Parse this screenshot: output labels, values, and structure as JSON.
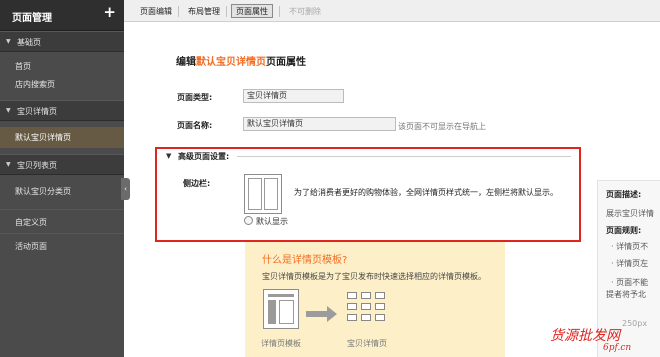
{
  "sidebar": {
    "title": "页面管理",
    "add_icon": "+",
    "sections": [
      {
        "label": "基础页",
        "items": [
          "首页",
          "店内搜索页"
        ]
      },
      {
        "label": "宝贝详情页",
        "items": [
          "默认宝贝详情页"
        ]
      },
      {
        "label": "宝贝列表页",
        "items": [
          "默认宝贝分类页"
        ]
      }
    ],
    "extra_items": [
      "自定义页",
      "活动页面"
    ],
    "collapse_icon": "‹"
  },
  "topbar": {
    "tabs": [
      "页面编辑",
      "布局管理",
      "页面属性",
      "不可删除"
    ]
  },
  "main": {
    "heading_prefix": "编辑",
    "heading_highlight": "默认宝贝详情页",
    "heading_suffix": "页面属性",
    "type_label": "页面类型:",
    "type_value": "宝贝详情页",
    "name_label": "页面名称:",
    "name_value": "默认宝贝详情页",
    "name_hint": "该页面不可显示在导航上",
    "advanced_title": "高级页面设置:",
    "sidebar_label": "侧边栏:",
    "layout_desc": "为了给消费者更好的购物体验，全网详情页样式统一，左侧栏将默认显示。",
    "radio_label": "默认显示"
  },
  "info": {
    "title": "什么是详情页模板?",
    "desc": "宝贝详情页模板是为了宝贝发布时快速选择相应的详情页模板。",
    "caption_left": "详情页模板",
    "caption_right": "宝贝详情页"
  },
  "right_panel": {
    "desc_title": "页面描述:",
    "desc_text": "展示宝贝详情",
    "rules_title": "页面规则:",
    "rules": [
      "· 详情页不",
      "· 详情页左",
      "· 页面不能",
      "提者将予北"
    ],
    "footer": "250px"
  },
  "watermark": {
    "text": "货源批发网",
    "site": "6pf.cn"
  },
  "colors": {
    "accent": "#f36c21",
    "highlight_border": "#e0251f",
    "sidebar_bg": "#4b4b4b",
    "sidebar_active": "#665a44",
    "info_bg": "#fdf0c9"
  },
  "icons": {
    "add": "plus-icon",
    "collapse": "chevron-left-icon",
    "section": "triangle-down-icon",
    "arrow": "arrow-right-icon"
  }
}
